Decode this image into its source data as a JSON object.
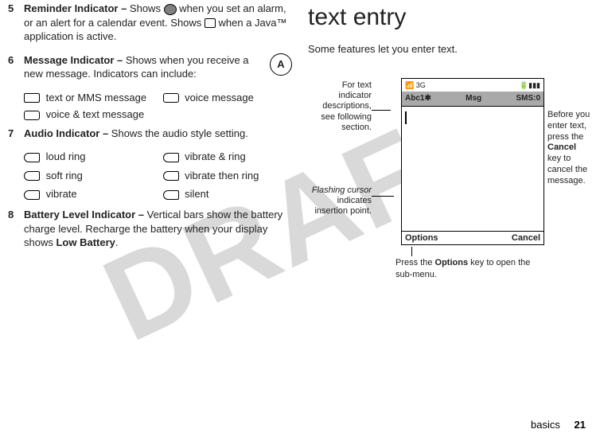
{
  "watermark": "DRAFT",
  "left": {
    "item5": {
      "num": "5",
      "label": "Reminder Indicator – ",
      "text1": "Shows ",
      "icon1": "round-alarm-icon",
      "text2": " when you set an alarm, or an alert for a calendar event. Shows ",
      "icon2": "java-icon",
      "text3": " when a Java™ application is active."
    },
    "item6": {
      "num": "6",
      "label": "Message Indicator – ",
      "text": "Shows when you receive a new message. Indicators can include:",
      "floaticon": "A",
      "sub": {
        "a": "text or MMS message",
        "b": "voice message",
        "c": "voice & text message"
      }
    },
    "item7": {
      "num": "7",
      "label": "Audio Indicator – ",
      "text": "Shows the audio style setting.",
      "sub": {
        "a": "loud ring",
        "b": "vibrate & ring",
        "c": "soft ring",
        "d": "vibrate then ring",
        "e": "vibrate",
        "f": "silent"
      }
    },
    "item8": {
      "num": "8",
      "label": "Battery Level Indicator – ",
      "text1": "Vertical bars show the battery charge level. Recharge the battery when your display shows ",
      "lb": "Low Battery",
      "text2": "."
    }
  },
  "right": {
    "heading": "text entry",
    "intro": "Some features let you enter text.",
    "callout_left_top": "For text indicator descriptions, see following section.",
    "callout_left_mid_em": "Flashing cursor",
    "callout_left_mid_rest": " indicates insertion point.",
    "callout_right": {
      "l1": "Before you enter text, press the ",
      "b": "Cancel",
      "l2": " key to cancel the message."
    },
    "callout_bottom": {
      "t1": "Press the ",
      "b": "Options",
      "t2": " key to open the sub-menu."
    },
    "phone": {
      "status_left": "📶 3G",
      "status_right": "🔋▮▮▮",
      "title_left": "Abc1✱",
      "title_mid": "Msg",
      "title_right": "SMS:0",
      "soft_left": "Options",
      "soft_right": "Cancel"
    }
  },
  "footer": {
    "section": "basics",
    "page": "21"
  }
}
